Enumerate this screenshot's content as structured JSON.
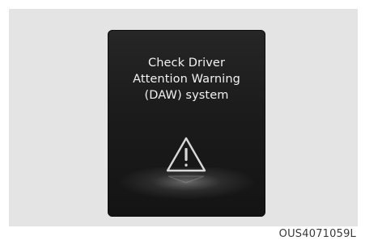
{
  "display": {
    "message_lines": [
      "Check Driver",
      "Attention Warning",
      "(DAW) system"
    ],
    "icon": "warning-triangle-icon"
  },
  "figure_code": "OUS4071059L"
}
